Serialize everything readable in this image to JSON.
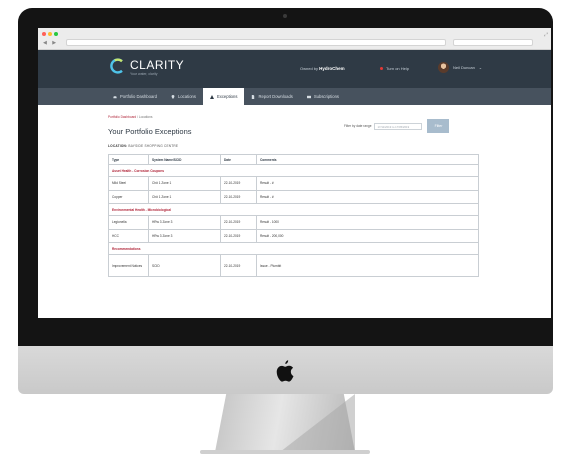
{
  "app": {
    "brand": "CLARITY",
    "tagline": "Your water, clarity",
    "owned_by_label": "Owned by",
    "owner_name": "HydroChem",
    "help_label": "Turn on Help",
    "user_name": "Neil Duncan",
    "user_menu_caret": "⌄"
  },
  "nav": {
    "tabs": [
      {
        "label": "Portfolio Dashboard",
        "icon": "car-icon"
      },
      {
        "label": "Locations",
        "icon": "map-pin-icon"
      },
      {
        "label": "Exceptions",
        "icon": "warning-icon",
        "active": true
      },
      {
        "label": "Report Downloads",
        "icon": "document-icon"
      },
      {
        "label": "Subscriptions",
        "icon": "envelope-icon"
      }
    ]
  },
  "breadcrumb": {
    "root": "Portfolio Dashboard",
    "separator": "/",
    "current": "Locations"
  },
  "page": {
    "title": "Your Portfolio Exceptions",
    "location_label": "LOCATION:",
    "location_value": "BAYSIDE SHOPPING CENTRE"
  },
  "filter": {
    "label": "Filter by date range",
    "placeholder": "17/11/2019 to 17/05/2019",
    "button_label": "Filter"
  },
  "table": {
    "headers": [
      "Type",
      "System Name/SCID",
      "Date",
      "Comments"
    ],
    "groups": [
      {
        "title": "Asset Health - Corrosion Coupons",
        "rows": [
          [
            "Mild Steel",
            "Ch# 1 Zone 1",
            "22-10-2019",
            "Result - #"
          ],
          [
            "Copper",
            "Ch# 1 Zone 1",
            "22-10-2019",
            "Result - #"
          ]
        ]
      },
      {
        "title": "Environmental Health - Microbiological",
        "rows": [
          [
            "Legionella",
            "HRw 3 Zone 3",
            "22-10-2019",
            "Result - 1000"
          ],
          [
            "HCC",
            "HRw 3 Zone 3",
            "22-10-2019",
            "Result - 200,000"
          ]
        ]
      },
      {
        "title": "Recommendations",
        "rows": [
          [
            "Improvement Notices",
            "SCID",
            "22-10-2019",
            "Issue - Plumbit"
          ]
        ]
      }
    ]
  },
  "colors": {
    "header": "#2f3a45",
    "nav": "#47525e",
    "accent": "#b0263a",
    "button": "#a8bccd"
  }
}
